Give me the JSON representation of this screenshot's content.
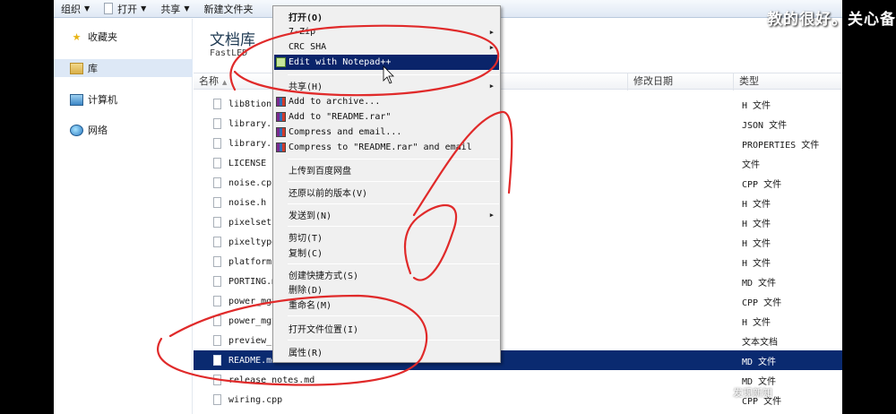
{
  "toolbar": {
    "organize": "组织",
    "open": "打开",
    "share": "共享",
    "new_folder": "新建文件夹"
  },
  "nav": {
    "items": [
      {
        "label": "收藏夹",
        "icon": "star-icon"
      },
      {
        "label": "库",
        "icon": "library-icon"
      },
      {
        "label": "计算机",
        "icon": "computer-icon"
      },
      {
        "label": "网络",
        "icon": "network-icon"
      }
    ]
  },
  "library": {
    "title": "文档库",
    "subtitle": "FastLED"
  },
  "columns": {
    "name": "名称",
    "date": "修改日期",
    "type": "类型"
  },
  "files": [
    {
      "name": "lib8tion.h",
      "type": "H 文件"
    },
    {
      "name": "library.json",
      "type": "JSON 文件"
    },
    {
      "name": "library.properties",
      "type": "PROPERTIES 文件"
    },
    {
      "name": "LICENSE",
      "type": "文件"
    },
    {
      "name": "noise.cpp",
      "type": "CPP 文件"
    },
    {
      "name": "noise.h",
      "type": "H 文件"
    },
    {
      "name": "pixelset.h",
      "type": "H 文件"
    },
    {
      "name": "pixeltypes.h",
      "type": "H 文件"
    },
    {
      "name": "platforms.h",
      "type": "H 文件"
    },
    {
      "name": "PORTING.md",
      "type": "MD 文件"
    },
    {
      "name": "power_mgt.cpp",
      "type": "CPP 文件"
    },
    {
      "name": "power_mgt.h",
      "type": "H 文件"
    },
    {
      "name": "preview_changes.txt",
      "type": "文本文档"
    },
    {
      "name": "README.md",
      "type": "MD 文件"
    },
    {
      "name": "release_notes.md",
      "type": "MD 文件"
    },
    {
      "name": "wiring.cpp",
      "type": "CPP 文件"
    }
  ],
  "context_menu": {
    "open": "打开(O)",
    "seven_zip": "7-Zip",
    "crc_sha": "CRC SHA",
    "edit_notepad": "Edit with Notepad++",
    "share": "共享(H)",
    "add_archive": "Add to archive...",
    "add_rar": "Add to \"README.rar\"",
    "compress_email": "Compress and email...",
    "compress_rar_email": "Compress to \"README.rar\" and email",
    "upload_baidu": "上传到百度网盘",
    "restore_versions": "还原以前的版本(V)",
    "send_to": "发送到(N)",
    "cut": "剪切(T)",
    "copy": "复制(C)",
    "create_shortcut": "创建快捷方式(S)",
    "delete": "删除(D)",
    "rename": "重命名(M)",
    "open_location": "打开文件位置(I)",
    "properties": "属性(R)"
  },
  "overlay": {
    "comment": "教的很好。关心备"
  },
  "watermark": "发现新知"
}
